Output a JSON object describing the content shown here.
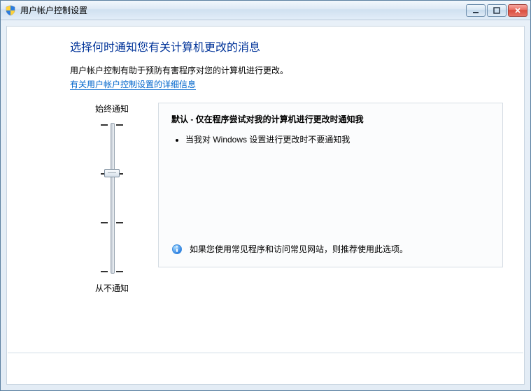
{
  "window": {
    "title": "用户帐户控制设置"
  },
  "page": {
    "heading": "选择何时通知您有关计算机更改的消息",
    "description": "用户帐户控制有助于预防有害程序对您的计算机进行更改。",
    "help_link": "有关用户帐户控制设置的详细信息"
  },
  "slider": {
    "top_label": "始终通知",
    "bottom_label": "从不通知",
    "levels": 4,
    "selected_index": 1
  },
  "panel": {
    "title": "默认 - 仅在程序尝试对我的计算机进行更改时通知我",
    "bullets": [
      "当我对 Windows 设置进行更改时不要通知我"
    ],
    "recommendation": "如果您使用常见程序和访问常见网站，则推荐使用此选项。"
  }
}
